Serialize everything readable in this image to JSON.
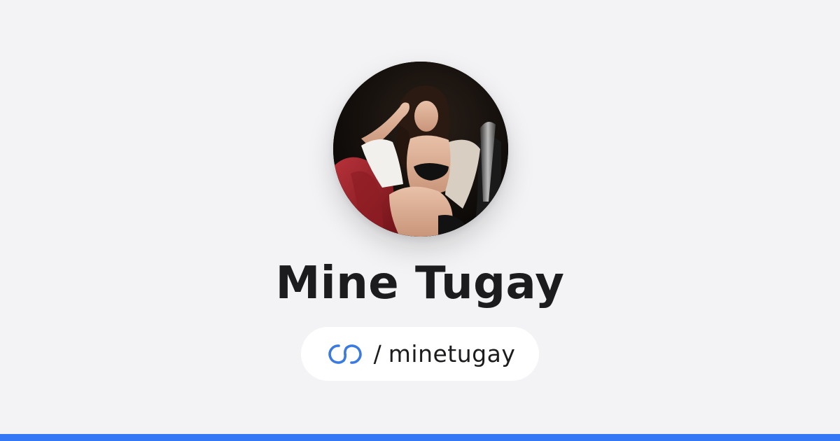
{
  "profile": {
    "display_name": "Mine Tugay",
    "slash": "/",
    "username": "minetugay",
    "avatar_alt": "Mine Tugay"
  },
  "icons": {
    "logo": "linked-rings-icon"
  },
  "colors": {
    "background": "#f3f3f5",
    "brand_accent": "#3b7ae0",
    "bottom_bar": "#3478f6",
    "pill_background": "#ffffff",
    "text": "#1c1c1e"
  }
}
